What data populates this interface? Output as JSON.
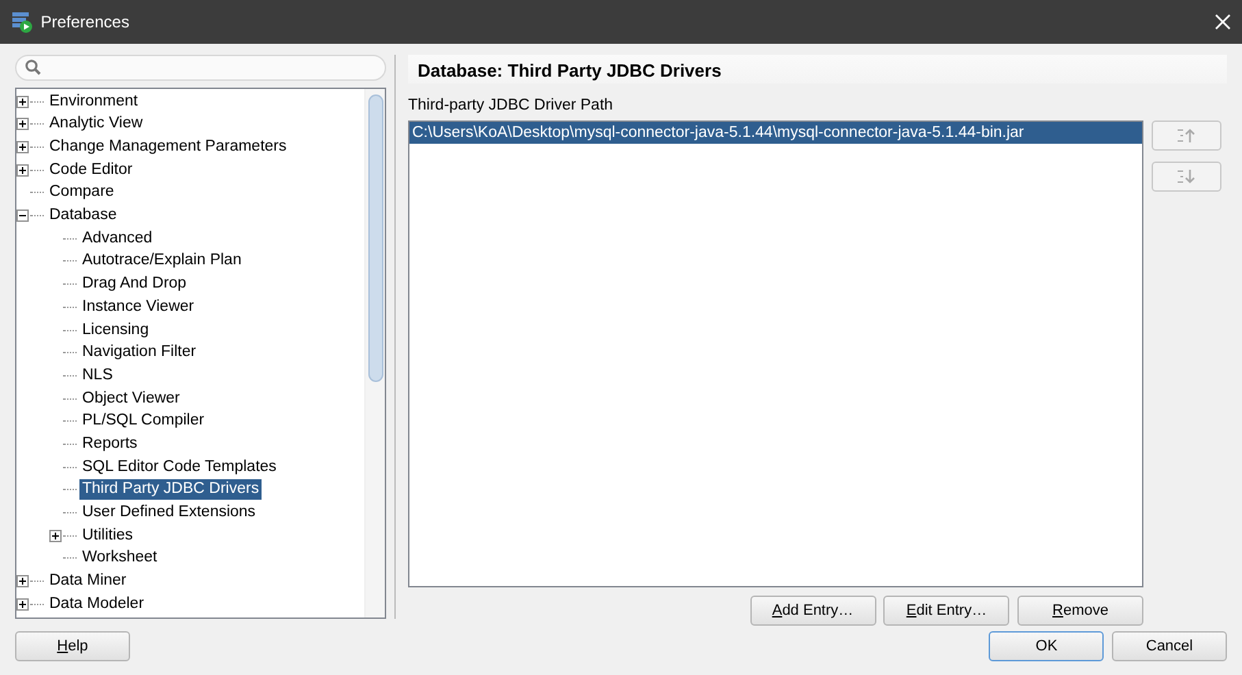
{
  "window": {
    "title": "Preferences"
  },
  "tree": [
    {
      "label": "Environment",
      "expanded": false,
      "selected": false
    },
    {
      "label": "Analytic View",
      "expanded": false,
      "selected": false
    },
    {
      "label": "Change Management Parameters",
      "expanded": false,
      "selected": false
    },
    {
      "label": "Code Editor",
      "expanded": false,
      "selected": false
    },
    {
      "label": "Compare",
      "selected": false
    },
    {
      "label": "Database",
      "expanded": true,
      "selected": false,
      "children": [
        {
          "label": "Advanced",
          "selected": false
        },
        {
          "label": "Autotrace/Explain Plan",
          "selected": false
        },
        {
          "label": "Drag And Drop",
          "selected": false
        },
        {
          "label": "Instance Viewer",
          "selected": false
        },
        {
          "label": "Licensing",
          "selected": false
        },
        {
          "label": "Navigation Filter",
          "selected": false
        },
        {
          "label": "NLS",
          "selected": false
        },
        {
          "label": "Object Viewer",
          "selected": false
        },
        {
          "label": "PL/SQL Compiler",
          "selected": false
        },
        {
          "label": "Reports",
          "selected": false
        },
        {
          "label": "SQL Editor Code Templates",
          "selected": false
        },
        {
          "label": "Third Party JDBC Drivers",
          "selected": true
        },
        {
          "label": "User Defined Extensions",
          "selected": false
        },
        {
          "label": "Utilities",
          "expanded": false,
          "selected": false
        },
        {
          "label": "Worksheet",
          "selected": false
        }
      ]
    },
    {
      "label": "Data Miner",
      "expanded": false,
      "selected": false
    },
    {
      "label": "Data Modeler",
      "expanded": false,
      "selected": false
    }
  ],
  "page": {
    "title": "Database: Third Party JDBC Drivers",
    "path_label": "Third-party JDBC Driver Path",
    "paths": [
      {
        "text": "C:\\Users\\KoA\\Desktop\\mysql-connector-java-5.1.44\\mysql-connector-java-5.1.44-bin.jar",
        "selected": true
      }
    ],
    "side_buttons": [
      {
        "kind": "move-up",
        "disabled": true
      },
      {
        "kind": "move-down",
        "disabled": true
      }
    ],
    "buttons": [
      {
        "label": "Add Entry…",
        "mnemonic": true
      },
      {
        "label": "Edit Entry…",
        "mnemonic": true
      },
      {
        "label": "Remove",
        "mnemonic": true
      }
    ]
  },
  "footer": {
    "left": [
      {
        "label": "Help",
        "mnemonic": true,
        "default": false
      }
    ],
    "right": [
      {
        "label": "OK",
        "mnemonic": false,
        "default": true
      },
      {
        "label": "Cancel",
        "mnemonic": false,
        "default": false
      }
    ]
  }
}
